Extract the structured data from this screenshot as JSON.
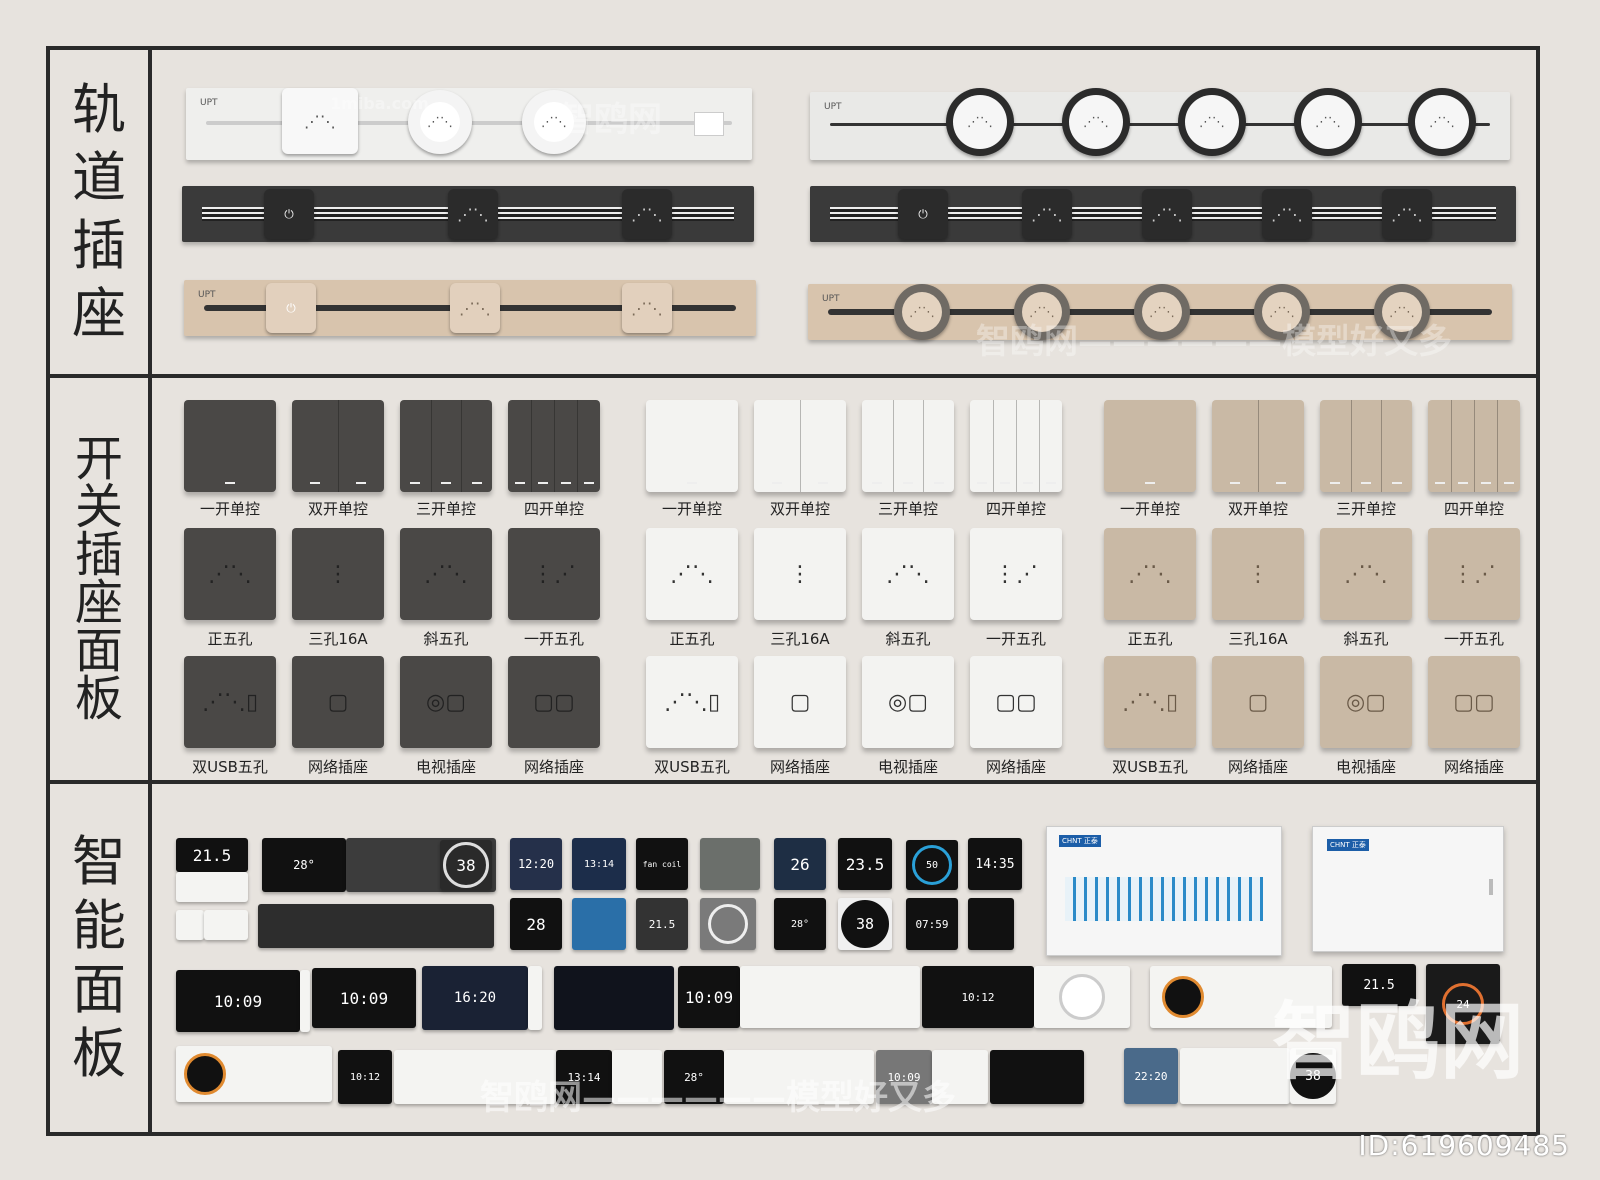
{
  "sections": {
    "rail_sockets": {
      "title_chars": [
        "轨",
        "道",
        "插",
        "座"
      ]
    },
    "switch_panels": {
      "title_chars": [
        "开",
        "关",
        "插",
        "座",
        "面",
        "板"
      ]
    },
    "smart_panels": {
      "title_chars": [
        "智",
        "能",
        "面",
        "板"
      ]
    }
  },
  "rails": {
    "brand_label": "UPT"
  },
  "switch_groups": [
    {
      "color": "#4a4846",
      "row1_labels": [
        "一开单控",
        "双开单控",
        "三开单控",
        "四开单控"
      ],
      "row2_labels": [
        "正五孔",
        "三孔16A",
        "斜五孔",
        "一开五孔"
      ],
      "row3_labels": [
        "双USB五孔",
        "网络插座",
        "电视插座",
        "网络插座"
      ]
    },
    {
      "color": "#f3f3f1",
      "row1_labels": [
        "一开单控",
        "双开单控",
        "三开单控",
        "四开单控"
      ],
      "row2_labels": [
        "正五孔",
        "三孔16A",
        "斜五孔",
        "一开五孔"
      ],
      "row3_labels": [
        "双USB五孔",
        "网络插座",
        "电视插座",
        "网络插座"
      ]
    },
    {
      "color": "#c9b9a5",
      "row1_labels": [
        "一开单控",
        "双开单控",
        "三开单控",
        "四开单控"
      ],
      "row2_labels": [
        "正五孔",
        "三孔16A",
        "斜五孔",
        "一开五孔"
      ],
      "row3_labels": [
        "双USB五孔",
        "网络插座",
        "电视插座",
        "网络插座"
      ]
    }
  ],
  "smart_screens": {
    "t1": "21.5",
    "t2": "28°",
    "t3": "38",
    "t4": "12:20",
    "t5": "13:14",
    "t6": "fan coil",
    "t7": "26",
    "t8": "23.5",
    "t9": "50",
    "t10": "14:35",
    "t11": "28",
    "t12": "21.5",
    "t13": "28°",
    "t14": "38",
    "t15": "07:59",
    "t16": "10:09",
    "t17": "10:09",
    "t18": "16:20",
    "t19": "10:09",
    "t20": "10:12",
    "t21": "21.5",
    "t22": "24",
    "t23": "10:12",
    "t24": "13:14",
    "t25": "28°",
    "t26": "10:09",
    "t27": "22:20",
    "t28": "38",
    "breaker_brand": "CHNT 正泰"
  },
  "watermarks": {
    "w1": "智鸥网",
    "w2": "1miba.com",
    "w3": "智鸥网——————模型好又多",
    "w4": "智鸥网"
  },
  "footer": {
    "id": "ID:619609485"
  },
  "colors": {
    "dark_panel": "#4a4846",
    "white_panel": "#f3f3f1",
    "beige_panel": "#c9b9a5",
    "frame": "#2a2a2a"
  }
}
